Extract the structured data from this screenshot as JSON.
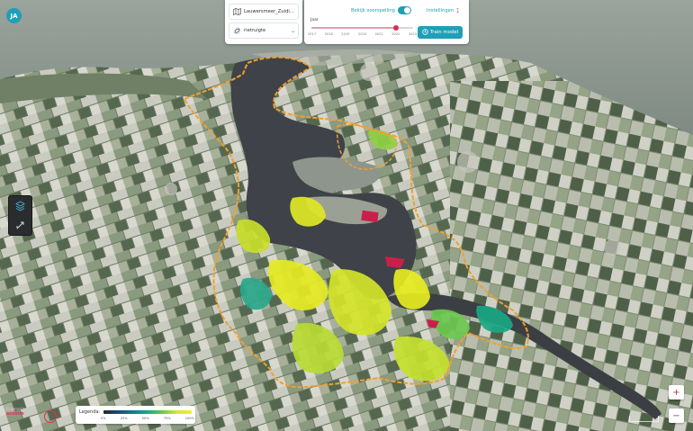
{
  "user": {
    "initials": "JA"
  },
  "selectors": {
    "area": "Lauwersmeer_Zuidi...",
    "species": "rietruigte"
  },
  "forecast": {
    "toggle_label": "Bekijk voorspelling",
    "toggle_on": true,
    "settings_label": "Instellingen",
    "year_label": "Jaar",
    "years": [
      "2017",
      "2018",
      "2019",
      "2020",
      "2021",
      "2022",
      "2023"
    ],
    "selected_year": "2022",
    "train_label": "Train model"
  },
  "legend": {
    "title": "Legenda:",
    "ticks": [
      "0%",
      "25%",
      "50%",
      "75%",
      "100%"
    ]
  },
  "zoom": {
    "in": "+",
    "out": "−"
  },
  "attribution": {
    "line1": "Powered by",
    "brand": "ecosim"
  },
  "colors": {
    "accent": "#1f9fb8",
    "brand_red": "#d0305a",
    "boundary": "#f0a030"
  },
  "icons": [
    "map-icon",
    "leaf-icon",
    "chevron-down-icon",
    "flag-icon",
    "train-icon",
    "layers-icon",
    "draw-icon"
  ]
}
